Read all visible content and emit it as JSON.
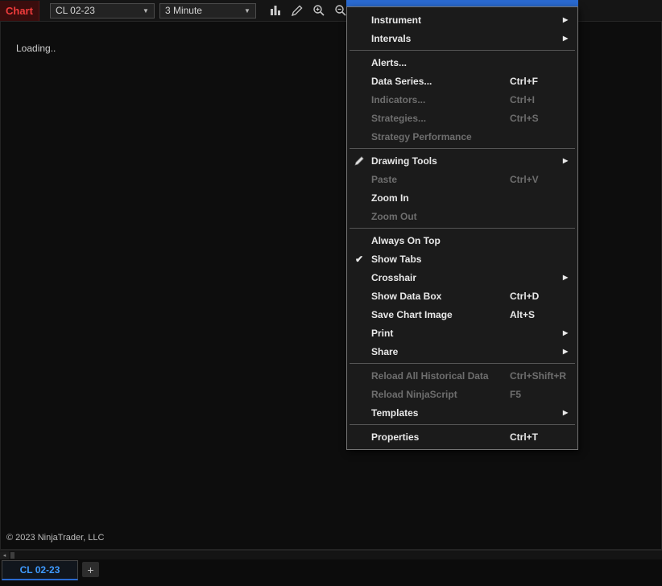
{
  "colors": {
    "accent_blue": "#2a6ad0",
    "chart_label_red": "#f03c3c",
    "tab_text_blue": "#3f9bff",
    "menu_bg": "#1b1b1b",
    "window_bg": "#0c0c0c"
  },
  "toolbar": {
    "chart_label": "Chart",
    "instrument_value": "CL 02-23",
    "interval_value": "3 Minute",
    "icons": [
      "chart-style-icon",
      "drawing-tools-icon",
      "zoom-in-icon",
      "zoom-out-icon"
    ]
  },
  "chart": {
    "loading_text": "Loading..",
    "copyright": "© 2023 NinjaTrader, LLC"
  },
  "menu": {
    "items": [
      {
        "label": "Instrument",
        "submenu": true
      },
      {
        "label": "Intervals",
        "submenu": true
      },
      {
        "separator": true
      },
      {
        "label": "Alerts..."
      },
      {
        "label": "Data Series...",
        "shortcut": "Ctrl+F"
      },
      {
        "label": "Indicators...",
        "shortcut": "Ctrl+I",
        "disabled": true
      },
      {
        "label": "Strategies...",
        "shortcut": "Ctrl+S",
        "disabled": true
      },
      {
        "label": "Strategy Performance",
        "disabled": true
      },
      {
        "separator": true
      },
      {
        "label": "Drawing Tools",
        "submenu": true,
        "icon": "pencil"
      },
      {
        "label": "Paste",
        "shortcut": "Ctrl+V",
        "disabled": true
      },
      {
        "label": "Zoom In"
      },
      {
        "label": "Zoom Out",
        "disabled": true
      },
      {
        "separator": true
      },
      {
        "label": "Always On Top"
      },
      {
        "label": "Show Tabs",
        "checked": true
      },
      {
        "label": "Crosshair",
        "submenu": true
      },
      {
        "label": "Show Data Box",
        "shortcut": "Ctrl+D"
      },
      {
        "label": "Save Chart Image",
        "shortcut": "Alt+S"
      },
      {
        "label": "Print",
        "submenu": true
      },
      {
        "label": "Share",
        "submenu": true
      },
      {
        "separator": true
      },
      {
        "label": "Reload All Historical Data",
        "shortcut": "Ctrl+Shift+R",
        "disabled": true
      },
      {
        "label": "Reload NinjaScript",
        "shortcut": "F5",
        "disabled": true
      },
      {
        "label": "Templates",
        "submenu": true
      },
      {
        "separator": true
      },
      {
        "label": "Properties",
        "shortcut": "Ctrl+T"
      }
    ]
  },
  "scrollbar": {
    "left_arrow": "◂"
  },
  "tabbar": {
    "tabs": [
      {
        "label": "CL 02-23",
        "active": true
      }
    ],
    "add_label": "+"
  }
}
